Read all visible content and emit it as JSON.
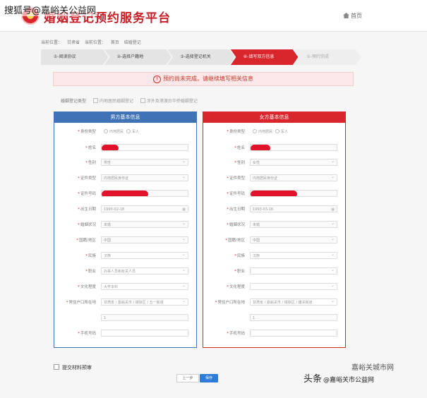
{
  "watermark": "搜狐号@嘉峪关公益网",
  "header": {
    "title": "婚姻登记预约服务平台",
    "home": "首页"
  },
  "breadcrumb": [
    "当前位置：",
    "甘肃省",
    "当前位置：",
    "首页",
    "结婚登记"
  ],
  "steps": [
    {
      "label": "①-阅读协议"
    },
    {
      "label": "②-选择户籍地"
    },
    {
      "label": "③-选择登记机关"
    },
    {
      "label": "④-填写双方信息"
    },
    {
      "label": "⑤-预约完成"
    }
  ],
  "notice": "预约尚未完成，请继续填写相关信息",
  "reg_type": {
    "label": "婚姻登记类型",
    "option1": "内地居民婚姻登记",
    "option2": "涉外及港澳台华侨婚姻登记"
  },
  "male": {
    "title": "男方基本信息",
    "identity_label": "身份类型",
    "identity_opt1": "内地居民",
    "identity_opt2": "军人",
    "name_label": "姓名",
    "gender_label": "性别",
    "gender_value": "男性",
    "id_type_label": "证件类型",
    "id_type_value": "内地居民身份证",
    "id_no_label": "证件号码",
    "birth_label": "出生日期",
    "birth_value": "1990-02-18",
    "marital_label": "婚姻状况",
    "marital_value": "未婚",
    "region_label": "国籍/地区",
    "region_value": "中国",
    "ethnic_label": "民族",
    "ethnic_value": "汉族",
    "job_label": "职业",
    "job_value": "办事人员和有关人员",
    "edu_label": "文化程度",
    "edu_value": "大学本科",
    "addr_label": "常住户口所在地",
    "addr_value": "甘肃省 / 嘉峪关市 / 镜铁区 / 五一街道",
    "addr_detail": "1",
    "phone_label": "手机号码"
  },
  "female": {
    "title": "女方基本信息",
    "identity_label": "身份类型",
    "identity_opt1": "内地居民",
    "identity_opt2": "军人",
    "name_label": "姓名",
    "gender_label": "性别",
    "gender_value": "女性",
    "id_type_label": "证件类型",
    "id_type_value": "内地居民身份证",
    "id_no_label": "证件号码",
    "birth_label": "出生日期",
    "birth_value": "1993-03-16",
    "marital_label": "婚姻状况",
    "marital_value": "未婚",
    "region_label": "国籍/地区",
    "region_value": "中国",
    "ethnic_label": "民族",
    "ethnic_value": "汉族",
    "job_label": "职业",
    "job_value": "",
    "edu_label": "文化程度",
    "edu_value": "",
    "addr_label": "常住户口所在地",
    "addr_value": "甘肃省 / 嘉峪关市 / 镜铁区 / 雄关街道",
    "addr_detail": "1",
    "phone_label": "手机号码"
  },
  "footer": {
    "submit_check": "提交材料预审",
    "prev": "上一步",
    "save": "保存"
  },
  "brand": {
    "main": "头条",
    "sub": "@嘉峪关市公益网",
    "corner": "嘉峪关城市网"
  },
  "colors": {
    "accent_red": "#d9262c",
    "male_blue": "#3f73b5",
    "button_blue": "#2e7bd8"
  }
}
